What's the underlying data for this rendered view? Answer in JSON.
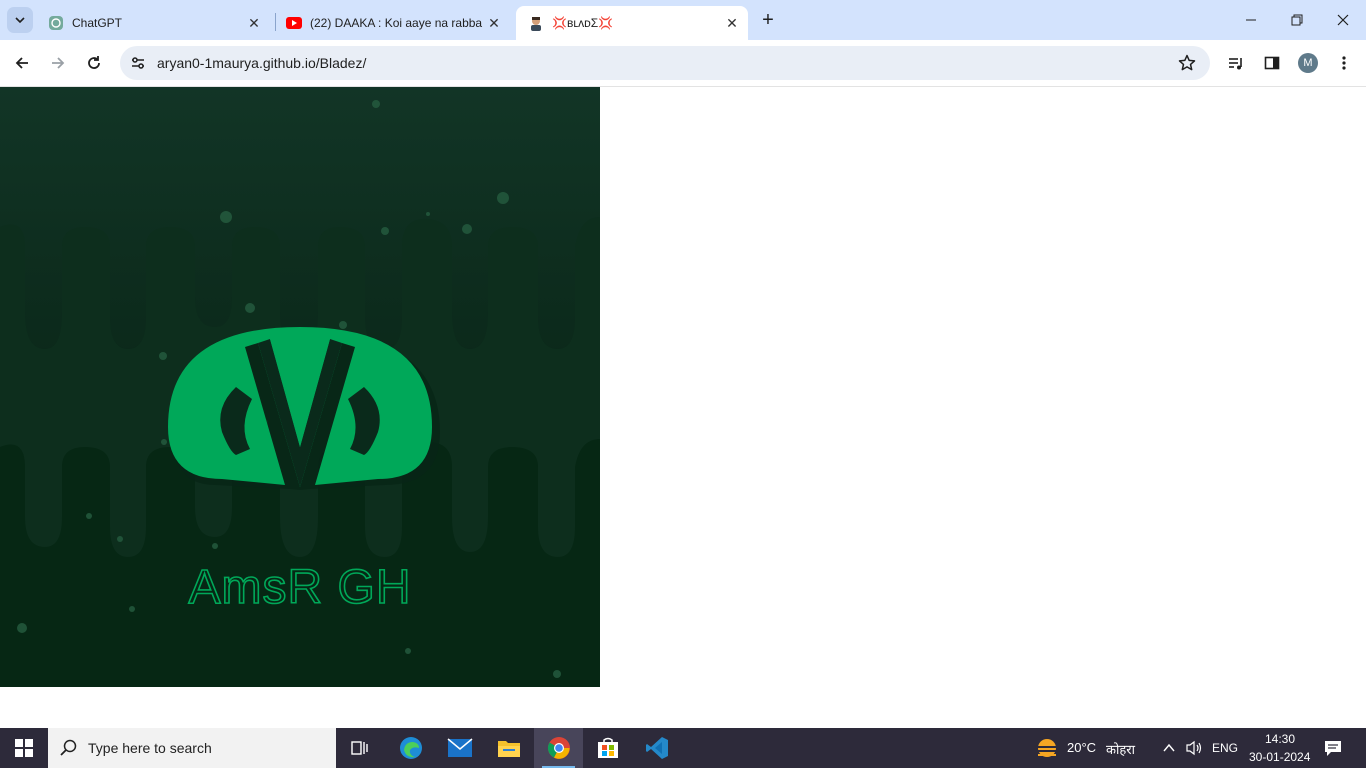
{
  "browser": {
    "tabs": [
      {
        "title": "ChatGPT",
        "favicon": "chatgpt-icon",
        "active": false
      },
      {
        "title": "(22) DAAKA : Koi aaye na rabba",
        "favicon": "youtube-icon",
        "active": false
      },
      {
        "title": "💢ʙʟᴧᴅΣ💢",
        "favicon": "site-icon",
        "active": true
      }
    ],
    "url": "aryan0-1maurya.github.io/Bladez/",
    "profile_initial": "M"
  },
  "page": {
    "logo_text": "AmsR GH",
    "colors": {
      "bg_dark": "#031d0d",
      "bg_mid": "#0e3320",
      "logo_green": "#00a859"
    }
  },
  "taskbar": {
    "search_placeholder": "Type here to search",
    "weather_temp": "20°C",
    "weather_desc": "कोहरा",
    "language": "ENG",
    "time": "14:30",
    "date": "30-01-2024"
  }
}
